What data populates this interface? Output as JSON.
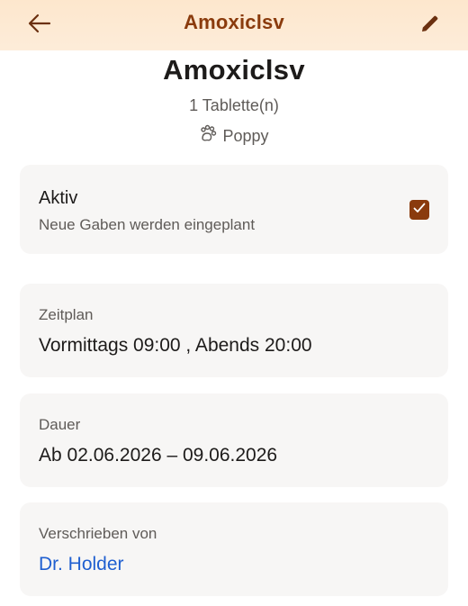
{
  "appbar": {
    "title": "Amoxiclsv",
    "back_icon": "arrow-left-icon",
    "edit_icon": "pencil-icon"
  },
  "header": {
    "name": "Amoxiclsv",
    "dose": "1 Tablette(n)",
    "pet_icon": "paw-icon",
    "pet_name": "Poppy"
  },
  "active_card": {
    "label": "Aktiv",
    "subtitle": "Neue Gaben werden eingeplant",
    "checked": true
  },
  "schedule_card": {
    "caption": "Zeitplan",
    "value": "Vormittags 09:00 , Abends 20:00"
  },
  "duration_card": {
    "caption": "Dauer",
    "value": "Ab 02.06.2026 – 09.06.2026"
  },
  "prescriber_card": {
    "caption": "Verschrieben von",
    "value": "Dr. Holder"
  },
  "colors": {
    "accent": "#8a3b0d",
    "appbar_bg": "#fde7cd",
    "link": "#1f5fd0",
    "card_bg": "#f7f6f5"
  }
}
